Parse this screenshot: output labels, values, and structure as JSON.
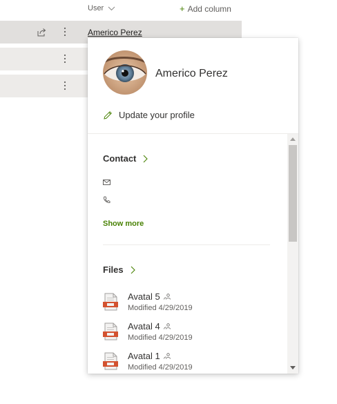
{
  "header": {
    "user_column": "User",
    "add_column": "Add column"
  },
  "rows": [
    {
      "user": "Americo Perez"
    },
    {
      "user": ""
    },
    {
      "user": ""
    }
  ],
  "card": {
    "name": "Americo Perez",
    "update_profile": "Update your profile",
    "contact": {
      "title": "Contact",
      "show_more": "Show more"
    },
    "files": {
      "title": "Files",
      "items": [
        {
          "name": "Avatal 5",
          "modified": "Modified 4/29/2019"
        },
        {
          "name": "Avatal 4",
          "modified": "Modified 4/29/2019"
        },
        {
          "name": "Avatal 1",
          "modified": "Modified 4/29/2019"
        }
      ]
    }
  },
  "colors": {
    "accent_green": "#498205",
    "row_background": "#edebe9",
    "row_selected": "#e1dfdd",
    "ppt_red": "#d35230"
  },
  "icons": [
    "chevron-down-icon",
    "plus-icon",
    "share-icon",
    "more-vertical-icon",
    "edit-pencil-icon",
    "chevron-right-icon",
    "mail-icon",
    "phone-icon",
    "powerpoint-file-icon",
    "shared-people-icon"
  ]
}
